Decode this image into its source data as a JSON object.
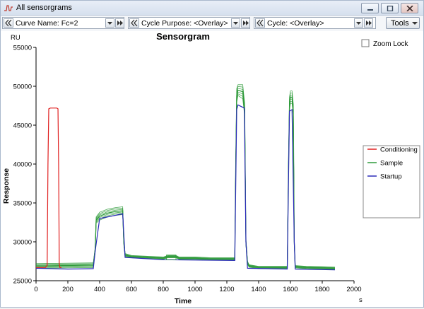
{
  "window": {
    "title": "All sensorgrams",
    "icon": "sensorgram-window-icon"
  },
  "toolbar": {
    "curve_name": "Curve Name: Fc=2",
    "cycle_purpose": "Cycle Purpose: <Overlay>",
    "cycle": "Cycle: <Overlay>",
    "tools_label": "Tools"
  },
  "zoom_lock": {
    "label": "Zoom Lock",
    "checked": false
  },
  "colors": {
    "conditioning": "#e02020",
    "sample": "#2e9a3a",
    "startup": "#2a2ab8",
    "accent_window": "#d6e0ee"
  },
  "chart_data": {
    "type": "line",
    "title": "Sensorgram",
    "xlabel": "Time",
    "ylabel": "Response",
    "yunit": "RU",
    "xunit": "s",
    "xlim": [
      0,
      2000
    ],
    "ylim": [
      25000,
      55000
    ],
    "x_ticks": [
      0,
      200,
      400,
      600,
      800,
      1000,
      1200,
      1400,
      1600,
      1800,
      2000
    ],
    "y_ticks": [
      25000,
      30000,
      35000,
      40000,
      45000,
      50000,
      55000
    ],
    "grid": false,
    "legend_position": "right",
    "series": [
      {
        "name": "Conditioning",
        "color": "#e02020",
        "x": [
          0,
          60,
          70,
          75,
          80,
          90,
          130,
          138,
          142,
          146,
          150,
          160
        ],
        "y": [
          26700,
          26700,
          27000,
          40000,
          47100,
          47200,
          47200,
          47100,
          40000,
          27200,
          26700,
          26700
        ]
      },
      {
        "name": "Sample",
        "color": "#2e9a3a",
        "x": [
          0,
          360,
          372,
          378,
          400,
          450,
          500,
          545,
          552,
          560,
          600,
          700,
          800,
          830,
          880,
          900,
          1000,
          1100,
          1200,
          1250,
          1256,
          1262,
          1270,
          1300,
          1312,
          1320,
          1330,
          1340,
          1400,
          1500,
          1580,
          1588,
          1594,
          1600,
          1610,
          1618,
          1624,
          1630,
          1700,
          1800,
          1880
        ],
        "y": [
          26900,
          27000,
          29000,
          32800,
          33300,
          33700,
          33900,
          34000,
          30000,
          28300,
          28100,
          28000,
          27900,
          28100,
          28100,
          27900,
          27900,
          27800,
          27800,
          27800,
          40000,
          48800,
          49500,
          49300,
          47000,
          30000,
          27300,
          26900,
          26700,
          26700,
          26700,
          40000,
          47800,
          48600,
          48600,
          47000,
          30000,
          26800,
          26700,
          26650,
          26600
        ],
        "band": [
          {
            "x": [
              0,
              360,
              372,
              378,
              400,
              450,
              500,
              545,
              552,
              560,
              600,
              700,
              800,
              830,
              880,
              900,
              1000,
              1100,
              1200,
              1250,
              1256,
              1262,
              1270,
              1300,
              1312,
              1320,
              1330,
              1340,
              1400,
              1500,
              1580,
              1588,
              1594,
              1600,
              1610,
              1618,
              1624,
              1630,
              1700,
              1800,
              1880
            ],
            "offsets": [
              300,
              300,
              300,
              400,
              500,
              500,
              500,
              500,
              400,
              200,
              150,
              150,
              150,
              150,
              150,
              150,
              150,
              150,
              150,
              150,
              500,
              900,
              700,
              900,
              800,
              400,
              200,
              150,
              150,
              150,
              150,
              500,
              800,
              800,
              800,
              700,
              300,
              150,
              150,
              150,
              150
            ]
          }
        ]
      },
      {
        "name": "Startup",
        "color": "#2a2ab8",
        "x": [
          0,
          100,
          200,
          360,
          372,
          400,
          545,
          560,
          800,
          1250,
          1262,
          1270,
          1310,
          1320,
          1330,
          1580,
          1594,
          1610,
          1624,
          1630,
          1880
        ],
        "y": [
          26600,
          26550,
          26500,
          26550,
          28800,
          33000,
          33600,
          28000,
          27700,
          27600,
          47000,
          47600,
          47200,
          30000,
          26600,
          26500,
          46800,
          47000,
          30000,
          26500,
          26400
        ]
      }
    ]
  }
}
